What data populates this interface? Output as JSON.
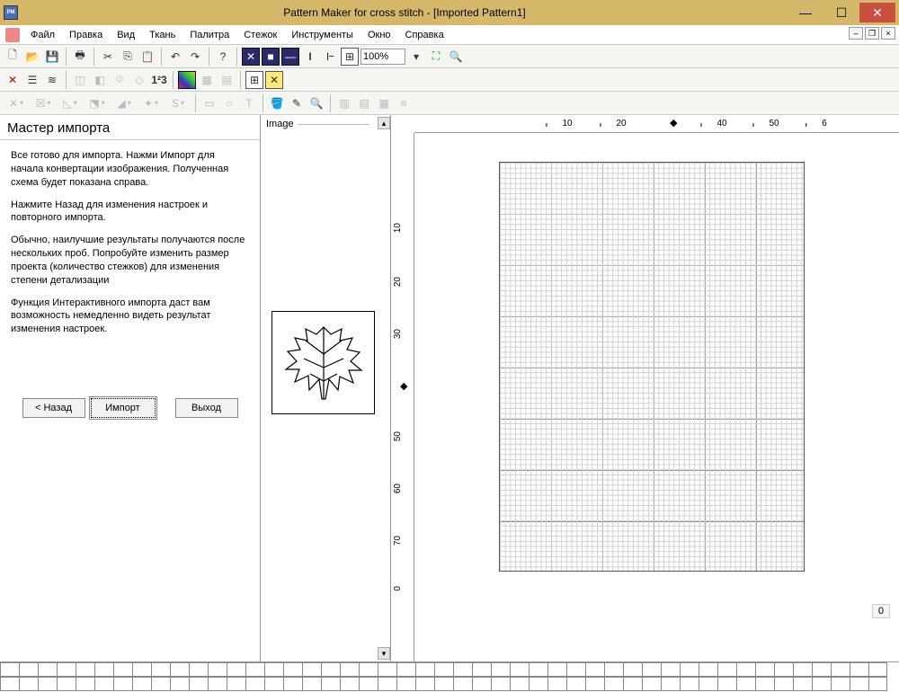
{
  "titlebar": {
    "title": "Pattern Maker for cross stitch - [Imported Pattern1]"
  },
  "menu": [
    "Файл",
    "Правка",
    "Вид",
    "Ткань",
    "Палитра",
    "Стежок",
    "Инструменты",
    "Окно",
    "Справка"
  ],
  "zoom": "100%",
  "wizard": {
    "title": "Мастер импорта",
    "p1": "Все готово для импорта.  Нажми Импорт для начала конвертации изображения.  Полученная схема будет показана справа.",
    "p2": "Нажмите Назад для изменения настроек и повторного импорта.",
    "p3": "Обычно, наилучшие результаты получаются после нескольких проб. Попробуйте изменить размер проекта (количество стежков) для изменения степени детализации",
    "p4": "Функция Интерактивного импорта даст вам возможность немедленно видеть результат изменения настроек.",
    "back": "< Назад",
    "import": "Импорт",
    "exit": "Выход"
  },
  "imagePanel": {
    "label": "Image"
  },
  "ruler": {
    "h": [
      "10",
      "20",
      "",
      "40",
      "50",
      "6"
    ],
    "v": [
      "10",
      "20",
      "30",
      "",
      "50",
      "60",
      "70",
      "0"
    ]
  },
  "status": "0"
}
